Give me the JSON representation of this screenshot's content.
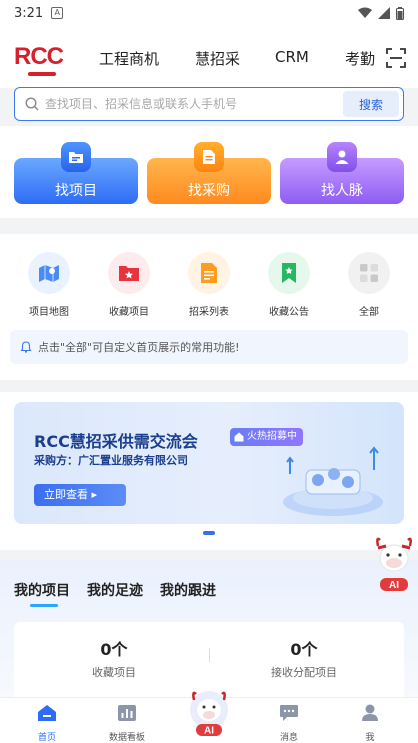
{
  "status_bar": {
    "time": "3:21",
    "notification_glyph": "A"
  },
  "header": {
    "logo_text": "RCC",
    "tabs": [
      {
        "label": "工程商机"
      },
      {
        "label": "慧招采"
      },
      {
        "label": "CRM"
      },
      {
        "label": "考勤"
      }
    ]
  },
  "search": {
    "placeholder": "查找项目、招采信息或联系人手机号",
    "button_label": "搜索"
  },
  "actions": [
    {
      "label": "找项目",
      "icon": "folder-icon",
      "color": "#2e6cf6"
    },
    {
      "label": "找采购",
      "icon": "document-icon",
      "color": "#ff8a1f"
    },
    {
      "label": "找人脉",
      "icon": "person-icon",
      "color": "#8d5df3"
    }
  ],
  "features": [
    {
      "label": "项目地图",
      "icon": "map-icon"
    },
    {
      "label": "收藏项目",
      "icon": "star-folder-icon"
    },
    {
      "label": "招采列表",
      "icon": "list-doc-icon"
    },
    {
      "label": "收藏公告",
      "icon": "bookmark-icon"
    },
    {
      "label": "全部",
      "icon": "grid-icon"
    }
  ],
  "hint": {
    "text": "点击\"全部\"可自定义首页展示的常用功能!"
  },
  "banner": {
    "title": "RCC慧招采供需交流会",
    "tag": "火热招募中",
    "subtitle": "采购方：广汇置业服务有限公司",
    "button_label": "立即查看 ▸"
  },
  "mine": {
    "tabs": [
      {
        "label": "我的项目"
      },
      {
        "label": "我的足迹"
      },
      {
        "label": "我的跟进"
      }
    ],
    "stats": [
      {
        "value": "0个",
        "label": "收藏项目"
      },
      {
        "value": "0个",
        "label": "接收分配项目"
      }
    ]
  },
  "bottom_nav": {
    "items": [
      {
        "label": "首页",
        "icon": "home-icon"
      },
      {
        "label": "数据看板",
        "icon": "chart-icon"
      },
      {
        "label": "AI",
        "icon": "ai-mascot-icon"
      },
      {
        "label": "消息",
        "icon": "message-icon"
      },
      {
        "label": "我",
        "icon": "profile-icon"
      }
    ]
  },
  "mascot": {
    "label": "AI"
  },
  "colors": {
    "primary": "#2e6cf6",
    "brand_red": "#d6202b",
    "orange": "#ff8a1f",
    "purple": "#8d5df3"
  }
}
